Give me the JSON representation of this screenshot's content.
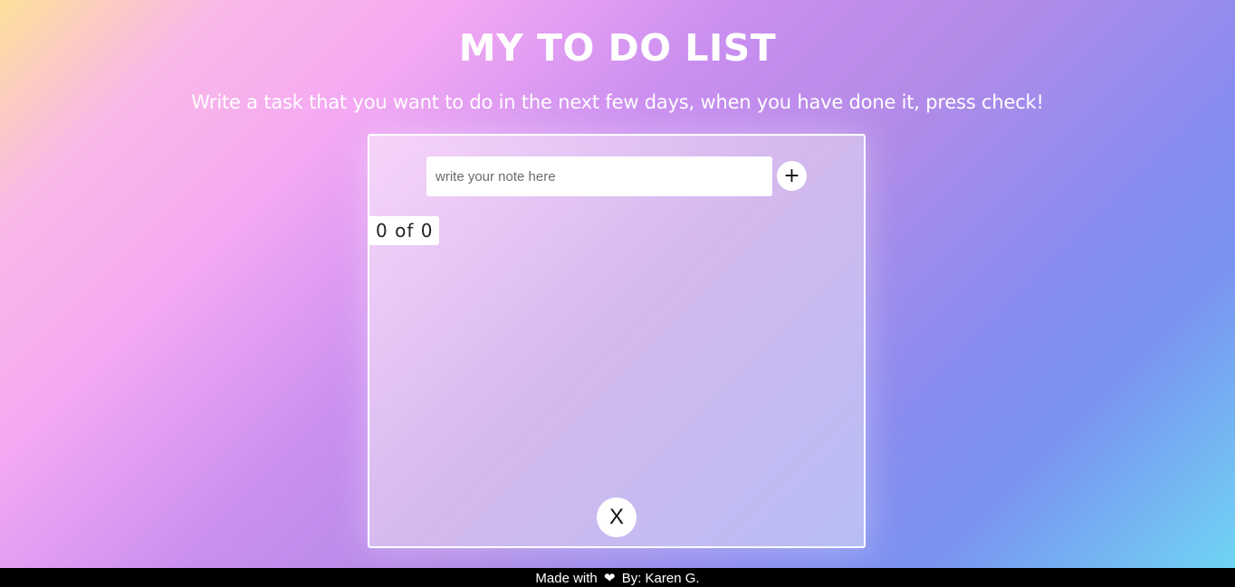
{
  "header": {
    "title": "MY TO DO LIST",
    "subtitle": "Write a task that you want to do in the next few days, when you have done it, press check!"
  },
  "todo": {
    "input_placeholder": "write your note here",
    "input_value": "",
    "add_label": "+",
    "counter": {
      "done": "0",
      "of": "of",
      "total": "0"
    },
    "clear_label": "X"
  },
  "footer": {
    "made_with": "Made with",
    "heart_icon": "heart-icon",
    "by": "By: Karen G."
  },
  "colors": {
    "gradient_start": "#ffe09a",
    "gradient_mid": "#b48be8",
    "gradient_end": "#6fd8f5",
    "footer_bg": "#000000",
    "text": "#ffffff"
  }
}
